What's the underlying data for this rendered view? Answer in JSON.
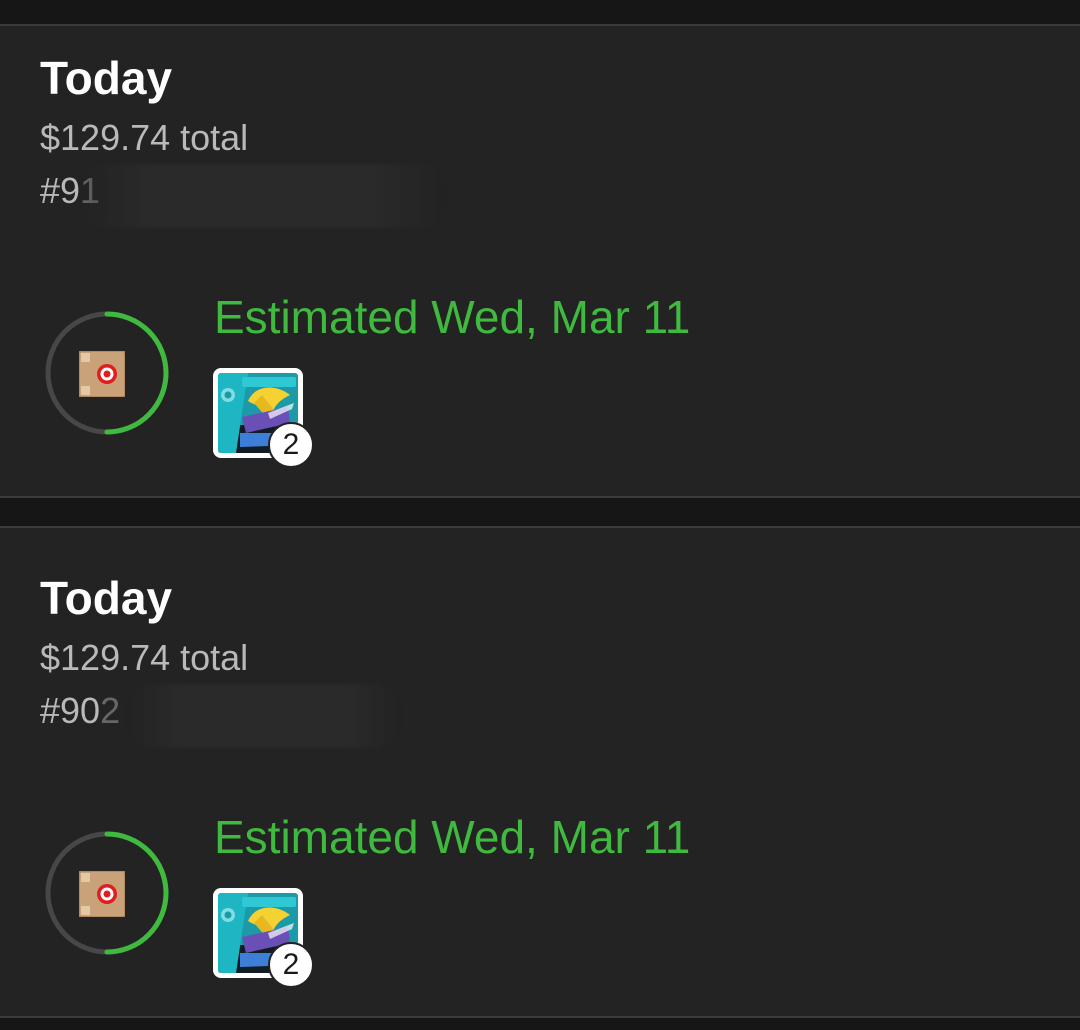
{
  "colors": {
    "background": "#161616",
    "card": "#232323",
    "accent_green": "#3fba3f",
    "ring_track": "#474747",
    "text_primary": "#ffffff",
    "text_secondary": "#b9b9b9"
  },
  "orders": [
    {
      "date_label": "Today",
      "total": "$129.74 total",
      "order_number_visible": "#9",
      "order_number_partial": "1",
      "estimated_delivery": "Estimated Wed, Mar 11",
      "delivery_progress": 0.5,
      "status_icon": "package-box-icon",
      "item_quantity": "2"
    },
    {
      "date_label": "Today",
      "total": "$129.74 total",
      "order_number_visible": "#90",
      "order_number_partial": "2",
      "estimated_delivery": "Estimated Wed, Mar 11",
      "delivery_progress": 0.5,
      "status_icon": "package-box-icon",
      "item_quantity": "2"
    }
  ]
}
